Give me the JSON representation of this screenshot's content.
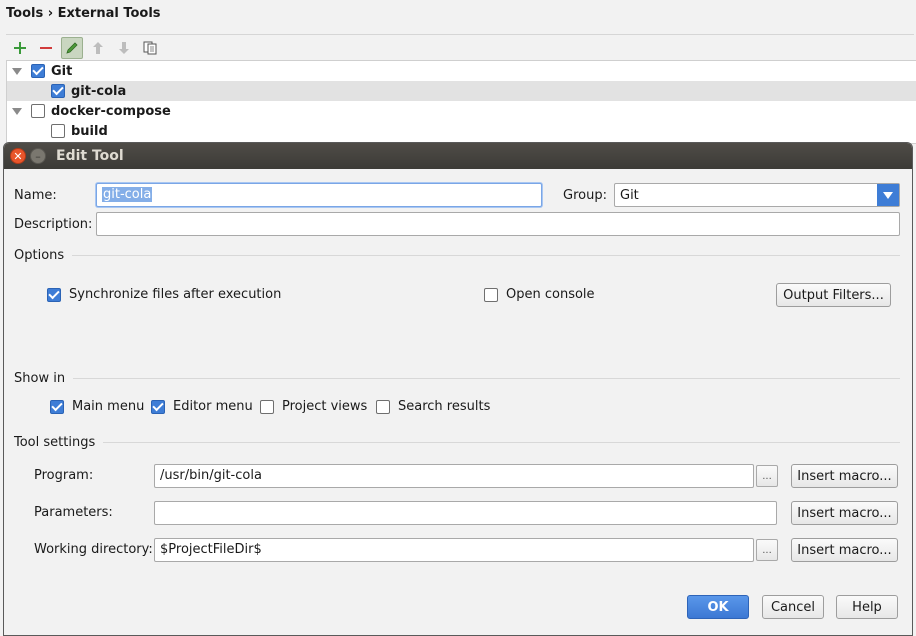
{
  "breadcrumb": {
    "parent": "Tools",
    "separator": "›",
    "current": "External Tools"
  },
  "toolbar": {
    "add_icon": "plus-icon",
    "remove_icon": "minus-icon",
    "edit_icon": "pencil-icon",
    "up_icon": "arrow-up-icon",
    "down_icon": "arrow-down-icon",
    "copy_icon": "copy-icon"
  },
  "tree": [
    {
      "label": "Git",
      "checked": true,
      "level": 0,
      "expanded": true,
      "selected": false
    },
    {
      "label": "git-cola",
      "checked": true,
      "level": 1,
      "selected": true
    },
    {
      "label": "docker-compose",
      "checked": false,
      "level": 0,
      "expanded": true,
      "selected": false
    },
    {
      "label": "build",
      "checked": false,
      "level": 1,
      "selected": false
    }
  ],
  "dialog": {
    "title": "Edit Tool",
    "name_label": "Name:",
    "name_value": "git-cola",
    "group_label": "Group:",
    "group_value": "Git",
    "description_label": "Description:",
    "description_value": "",
    "options_section": "Options",
    "sync_label": "Synchronize files after execution",
    "sync_checked": true,
    "open_console_label": "Open console",
    "open_console_checked": false,
    "output_filters_label": "Output Filters...",
    "show_in_section": "Show in",
    "show_in": [
      {
        "label": "Main menu",
        "checked": true
      },
      {
        "label": "Editor menu",
        "checked": true
      },
      {
        "label": "Project views",
        "checked": false
      },
      {
        "label": "Search results",
        "checked": false
      }
    ],
    "tool_settings_section": "Tool settings",
    "program_label": "Program:",
    "program_value": "/usr/bin/git-cola",
    "parameters_label": "Parameters:",
    "parameters_value": "",
    "working_dir_label": "Working directory:",
    "working_dir_value": "$ProjectFileDir$",
    "browse_label": "...",
    "insert_macro_label": "Insert macro...",
    "ok_label": "OK",
    "cancel_label": "Cancel",
    "help_label": "Help"
  },
  "colors": {
    "accent": "#3e7dd6",
    "titlebar": "#3c3b37",
    "close": "#e8552b"
  }
}
